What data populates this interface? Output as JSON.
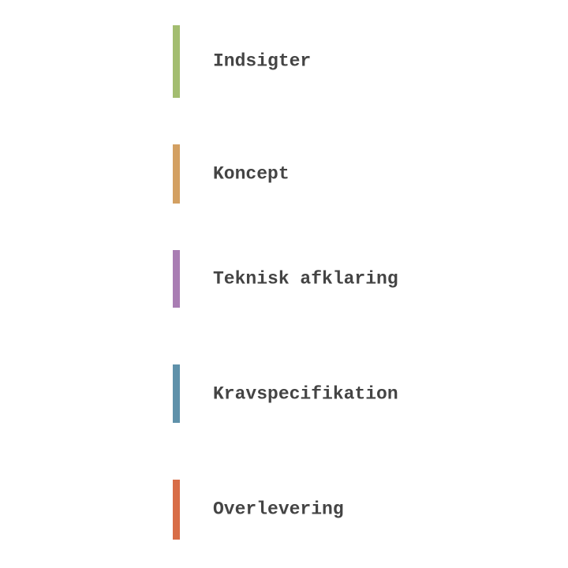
{
  "phases": [
    {
      "label": "Indsigter",
      "color": "#a3bd70"
    },
    {
      "label": "Koncept",
      "color": "#d3a062"
    },
    {
      "label": "Teknisk afklaring",
      "color": "#a97db3"
    },
    {
      "label": "Kravspecifikation",
      "color": "#5f91aa"
    },
    {
      "label": "Overlevering",
      "color": "#d86d47"
    }
  ]
}
